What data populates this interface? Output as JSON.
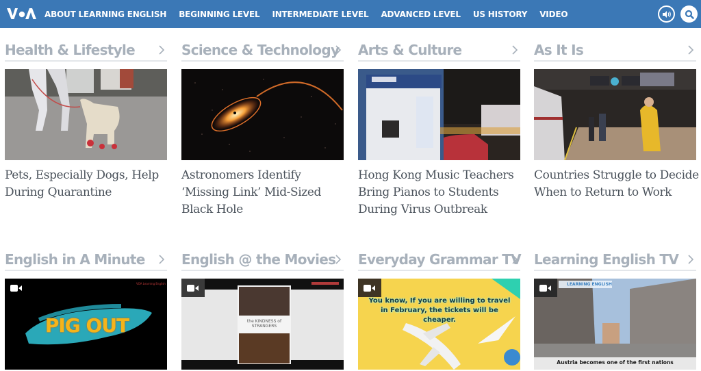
{
  "header": {
    "logo": "VOA",
    "nav": [
      {
        "label": "ABOUT LEARNING ENGLISH"
      },
      {
        "label": "BEGINNING LEVEL"
      },
      {
        "label": "INTERMEDIATE LEVEL"
      },
      {
        "label": "ADVANCED LEVEL"
      },
      {
        "label": "US HISTORY"
      },
      {
        "label": "VIDEO"
      }
    ],
    "icons": {
      "audio": "speaker-icon",
      "search": "search-icon"
    },
    "bar_color": "#3b78b6"
  },
  "sections": [
    {
      "title": "Health & Lifestyle",
      "headline": "Pets, Especially Dogs, Help During Quarantine",
      "image": "dog-walking-with-red-shoes",
      "video": false
    },
    {
      "title": "Science & Technology",
      "headline": "Astronomers Identify ‘Missing Link’ Mid-Sized Black Hole",
      "image": "black-hole-illustration",
      "video": false
    },
    {
      "title": "Arts & Culture",
      "headline": "Hong Kong Music Teachers Bring Pianos to Students During Virus Outbreak",
      "image": "mobile-piano-booth-street",
      "video": false
    },
    {
      "title": "As It Is",
      "headline": "Countries Struggle to Decide When to Return to Work",
      "image": "train-platform-commuters",
      "video": false
    },
    {
      "title": "English in A Minute",
      "image": "pig-out-title-card",
      "video": true,
      "overlay_text": "PIG OUT",
      "brand": "VOA Learning English"
    },
    {
      "title": "English @ the Movies",
      "image": "kindness-of-strangers-poster",
      "video": true,
      "overlay_text": "the KINDNESS of STRANGERS"
    },
    {
      "title": "Everyday Grammar TV",
      "image": "airplane-on-yellow",
      "video": true,
      "overlay_text": "You know, If you are willing to travel in February, the tickets will be cheaper."
    },
    {
      "title": "Learning English TV",
      "image": "vienna-empty-street",
      "video": true,
      "brand": "LEARNING ENGLISH",
      "caption": "Austria becomes one of the first nations"
    }
  ]
}
